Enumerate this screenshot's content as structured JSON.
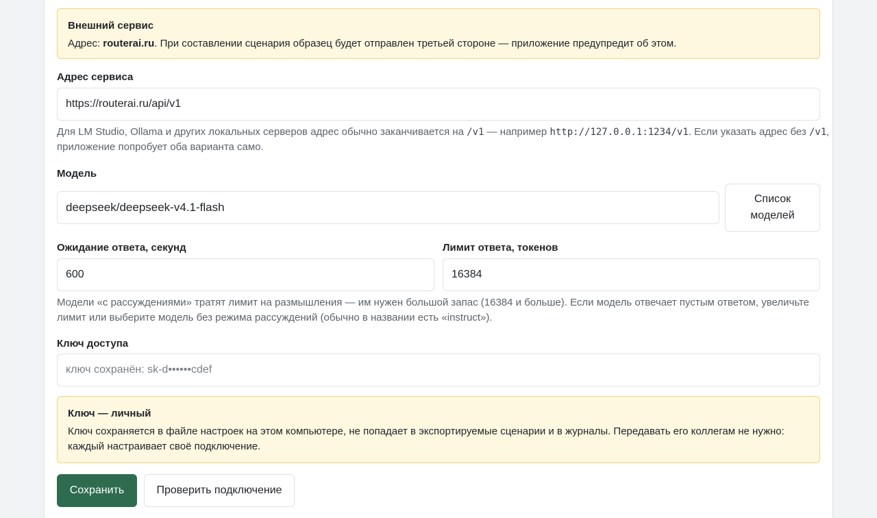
{
  "external_alert": {
    "title": "Внешний сервис",
    "prefix": "Адрес: ",
    "host": "routerai.ru",
    "suffix": ". При составлении сценария образец будет отправлен третьей стороне — приложение предупредит об этом."
  },
  "service_url": {
    "label": "Адрес сервиса",
    "value": "https://routerai.ru/api/v1",
    "help_1": "Для LM Studio, Ollama и других локальных серверов адрес обычно заканчивается на ",
    "code_1": "/v1",
    "help_2": " — например ",
    "code_2": "http://127.0.0.1:1234/v1",
    "help_3": ". Если указать адрес без ",
    "code_3": "/v1",
    "help_4": ",",
    "help_5": "приложение попробует оба варианта само."
  },
  "model": {
    "label": "Модель",
    "value": "deepseek/deepseek-v4.1-flash",
    "list_button": "Список моделей"
  },
  "timeout": {
    "label": "Ожидание ответа, секунд",
    "value": "600"
  },
  "token_limit": {
    "label": "Лимит ответа, токенов",
    "value": "16384"
  },
  "limit_help": {
    "line_1": "Модели «с рассуждениями» тратят лимит на размышления — им нужен большой запас (16384 и больше). Если модель отвечает пустым ответом, увеличьте",
    "line_2": "лимит или выберите модель без режима рассуждений (обычно в названии есть «instruct»)."
  },
  "api_key": {
    "label": "Ключ доступа",
    "placeholder": "ключ сохранён: sk-d••••••cdef"
  },
  "key_alert": {
    "title": "Ключ — личный",
    "line_1": "Ключ сохраняется в файле настроек на этом компьютере, не попадает в экспортируемые сценарии и в журналы. Передавать его коллегам не нужно:",
    "line_2": "каждый настраивает своё подключение."
  },
  "actions": {
    "save": "Сохранить",
    "test": "Проверить подключение"
  },
  "colors": {
    "primary": "#2e6b4f",
    "alert_bg": "#fff8e1",
    "alert_border": "#f3d27a"
  }
}
